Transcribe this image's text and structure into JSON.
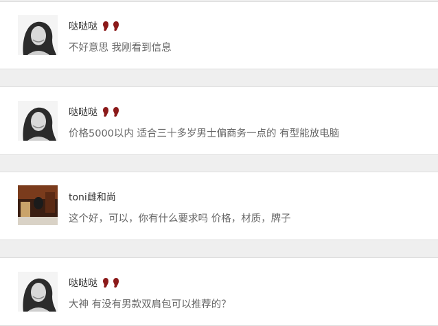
{
  "messages": [
    {
      "name": "哒哒哒",
      "text": "不好意思 我刚看到信息",
      "avatar": "woman-portrait",
      "badge": "footprints-icon"
    },
    {
      "name": "哒哒哒",
      "text": "价格5000以内 适合三十多岁男士偏商务一点的 有型能放电脑",
      "avatar": "woman-portrait",
      "badge": "footprints-icon"
    },
    {
      "name": "toni雌和尚",
      "text": "这个好，可以，你有什么要求吗 价格，材质，牌子",
      "avatar": "photo-thumbnail",
      "badge": ""
    },
    {
      "name": "哒哒哒",
      "text": "大神 有没有男款双肩包可以推荐的？",
      "avatar": "woman-portrait",
      "badge": "footprints-icon"
    }
  ],
  "colors": {
    "footprint": "#8b1a1a",
    "name": "#333333",
    "text": "#666666",
    "background": "#efefef"
  }
}
